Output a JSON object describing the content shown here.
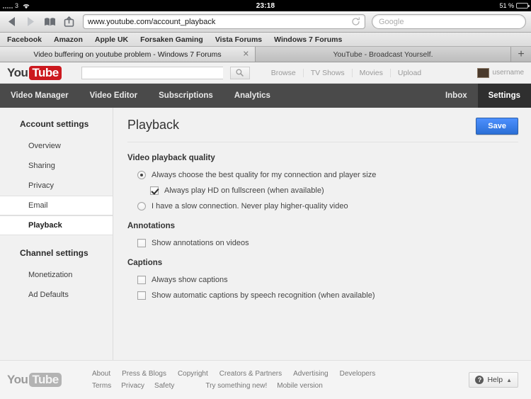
{
  "status_bar": {
    "carrier": "3",
    "wifi_icon": "wifi-icon",
    "time": "23:18",
    "battery_percent": "51 %",
    "battery_level": 51
  },
  "browser": {
    "back_icon": "back-arrow-icon",
    "forward_icon": "forward-arrow-icon",
    "bookmarks_icon": "book-icon",
    "share_icon": "share-icon",
    "url": "www.youtube.com/account_playback",
    "reload_icon": "reload-icon",
    "search_placeholder": "Google",
    "bookmarks": [
      "Facebook",
      "Amazon",
      "Apple UK",
      "Forsaken Gaming",
      "Vista Forums",
      "Windows 7 Forums"
    ],
    "tabs": [
      {
        "title": "Video buffering on youtube problem - Windows 7 Forums",
        "active": false,
        "close_icon": "close-icon"
      },
      {
        "title": "YouTube - Broadcast Yourself.",
        "active": true,
        "close_icon": "close-icon"
      }
    ],
    "new_tab_label": "+"
  },
  "youtube": {
    "logo": {
      "you": "You",
      "tube": "Tube"
    },
    "search_value": "",
    "search_icon": "search-icon",
    "header_links": [
      "Browse",
      "TV Shows",
      "Movies",
      "Upload"
    ],
    "username": "username",
    "avatar": "avatar",
    "nav": {
      "items": [
        {
          "label": "Video Manager",
          "active": false
        },
        {
          "label": "Video Editor",
          "active": false
        },
        {
          "label": "Subscriptions",
          "active": false
        },
        {
          "label": "Analytics",
          "active": false
        }
      ],
      "right_items": [
        {
          "label": "Inbox",
          "active": false
        },
        {
          "label": "Settings",
          "active": true
        }
      ]
    },
    "sidebar": {
      "account_heading": "Account settings",
      "account_items": [
        {
          "label": "Overview",
          "selected": false,
          "current": false
        },
        {
          "label": "Sharing",
          "selected": false,
          "current": false
        },
        {
          "label": "Privacy",
          "selected": false,
          "current": false
        },
        {
          "label": "Email",
          "selected": true,
          "current": false
        },
        {
          "label": "Playback",
          "selected": true,
          "current": true
        }
      ],
      "channel_heading": "Channel settings",
      "channel_items": [
        {
          "label": "Monetization",
          "selected": false,
          "current": false
        },
        {
          "label": "Ad Defaults",
          "selected": false,
          "current": false
        }
      ]
    },
    "main": {
      "title": "Playback",
      "save_label": "Save",
      "sections": [
        {
          "heading": "Video playback quality",
          "options": [
            {
              "type": "radio",
              "label": "Always choose the best quality for my connection and player size",
              "checked": true,
              "indent": false
            },
            {
              "type": "checkbox",
              "label": "Always play HD on fullscreen (when available)",
              "checked": true,
              "indent": true
            },
            {
              "type": "radio",
              "label": "I have a slow connection. Never play higher-quality video",
              "checked": false,
              "indent": false
            }
          ]
        },
        {
          "heading": "Annotations",
          "options": [
            {
              "type": "checkbox",
              "label": "Show annotations on videos",
              "checked": false,
              "indent": false
            }
          ]
        },
        {
          "heading": "Captions",
          "options": [
            {
              "type": "checkbox",
              "label": "Always show captions",
              "checked": false,
              "indent": false
            },
            {
              "type": "checkbox",
              "label": "Show automatic captions by speech recognition (when available)",
              "checked": false,
              "indent": false
            }
          ]
        }
      ]
    },
    "footer": {
      "logo": {
        "you": "You",
        "tube": "Tube"
      },
      "row1": [
        "About",
        "Press & Blogs",
        "Copyright",
        "Creators & Partners",
        "Advertising",
        "Developers"
      ],
      "row2": [
        "Terms",
        "Privacy",
        "Safety",
        "Try something new!",
        "Mobile version"
      ],
      "help_label": "Help",
      "help_icon": "question-mark-icon",
      "help_caret": "caret-up-icon"
    }
  },
  "colors": {
    "accent_red": "#cc181e",
    "save_blue": "#2b6fd6",
    "nav_dark": "#4a4a4a",
    "nav_active": "#2f2f2f"
  }
}
